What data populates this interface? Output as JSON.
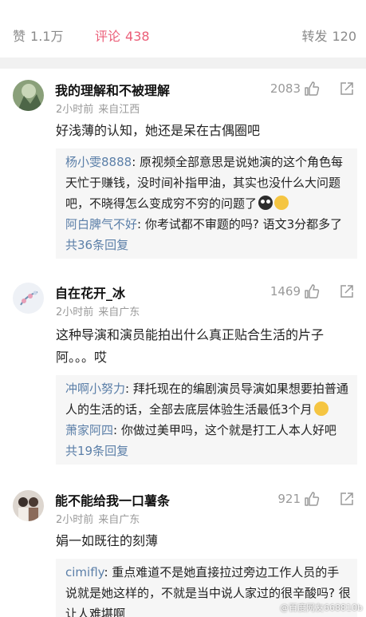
{
  "tabs": {
    "likes": {
      "label": "赞",
      "count": "1.1万"
    },
    "comments": {
      "label": "评论",
      "count": "438"
    },
    "reposts": {
      "label": "转发",
      "count": "120"
    }
  },
  "comments": [
    {
      "username": "我的理解和不被理解",
      "time": "2小时前",
      "location": "来自江西",
      "likes": "2083",
      "text": "好浅薄的认知，她还是呆在古偶圈吧",
      "replies": [
        {
          "name": "杨小雯8888",
          "text": "原视频全部意思是说她演的这个角色每天忙于赚钱，没时间补指甲油，其实也没什么大问题吧，不晓得怎么变成穷不穷的问题了"
        },
        {
          "name": "阿白脾气不好",
          "text": "你考试都不审题的吗? 语文3分都多了"
        }
      ],
      "more": "共36条回复"
    },
    {
      "username": "自在花开_冰",
      "time": "2小时前",
      "location": "来自广东",
      "likes": "1469",
      "text": "这种导演和演员能拍出什么真正贴合生活的片子阿。。。哎",
      "replies": [
        {
          "name": "冲啊小努力",
          "text": "拜托现在的编剧演员导演如果想要拍普通人的生活的话，全部去底层体验生活最低3个月"
        },
        {
          "name": "萧家阿四",
          "text": "你做过美甲吗，这个就是打工人本人好吧"
        }
      ],
      "more": "共19条回复"
    },
    {
      "username": "能不能给我一口薯条",
      "time": "2小时前",
      "location": "来自广东",
      "likes": "921",
      "text": "娟一如既往的刻薄",
      "replies": [
        {
          "name": "cimifly",
          "text": "重点难道不是她直接拉过旁边工作人员的手说就是她这样的，不就是当中说人家过的很辛酸吗? 很让人难堪啊"
        }
      ]
    }
  ],
  "watermark": "@百度网友668810b",
  "colors": {
    "accent": "#eb5e78",
    "link": "#5b7fa8",
    "muted": "#9a9a9a"
  }
}
